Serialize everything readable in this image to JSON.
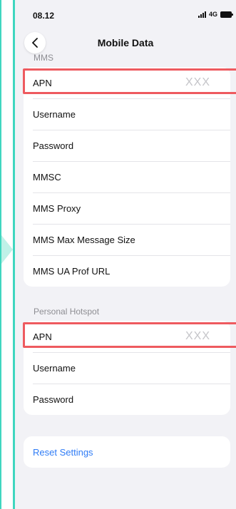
{
  "status_bar": {
    "time": "08.12",
    "network": "4G"
  },
  "nav": {
    "title": "Mobile Data"
  },
  "mms": {
    "header": "MMS",
    "rows": [
      {
        "label": "APN",
        "value": "XXX"
      },
      {
        "label": "Username"
      },
      {
        "label": "Password"
      },
      {
        "label": "MMSC"
      },
      {
        "label": "MMS Proxy"
      },
      {
        "label": "MMS Max Message Size"
      },
      {
        "label": "MMS UA Prof URL"
      }
    ]
  },
  "hotspot": {
    "header": "Personal Hotspot",
    "rows": [
      {
        "label": "APN",
        "value": "XXX"
      },
      {
        "label": "Username"
      },
      {
        "label": "Password"
      }
    ]
  },
  "reset": {
    "label": "Reset Settings"
  },
  "colors": {
    "accent": "#2f7cf6",
    "highlight": "#ee5a5f",
    "frame": "#3fd6bf"
  }
}
